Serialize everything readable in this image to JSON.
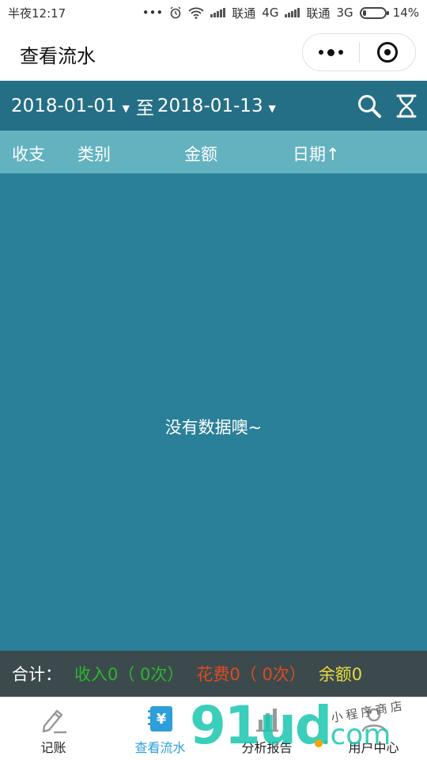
{
  "status_bar": {
    "time": "半夜12:17",
    "carrier1": "联通",
    "net1": "4G",
    "carrier2": "联通",
    "net2": "3G",
    "battery": "14%",
    "battery_level": 0.14
  },
  "header": {
    "title": "查看流水"
  },
  "filter": {
    "start_date": "2018-01-01",
    "separator": "至",
    "end_date": "2018-01-13",
    "search_icon": "search-icon",
    "hourglass_icon": "hourglass-icon"
  },
  "columns": [
    "收支",
    "类别",
    "金额",
    "日期↑"
  ],
  "empty_message": "没有数据噢~",
  "summary": {
    "label": "合计：",
    "income": "收入0（ 0次）",
    "spend": "花费0（ 0次）",
    "balance": "余额0",
    "colors": {
      "income": "#2bb82b",
      "spend": "#e04b1c",
      "balance": "#e9dc3c"
    }
  },
  "tabs": [
    {
      "label": "记账",
      "icon": "pencil-icon",
      "active": false
    },
    {
      "label": "查看流水",
      "icon": "yen-bill-icon",
      "active": true
    },
    {
      "label": "分析报告",
      "icon": "chart-icon",
      "active": false
    },
    {
      "label": "用户中心",
      "icon": "user-icon",
      "active": false
    }
  ],
  "watermark": {
    "main": "91ud",
    "domain": ".com",
    "tagline": "小程序商店"
  },
  "colors": {
    "filter_bar": "#256f86",
    "column_header": "#63b2c0",
    "main_bg": "#2b8099",
    "summary_bg": "#3c4a4e",
    "active_tab": "#2e9fd8"
  }
}
